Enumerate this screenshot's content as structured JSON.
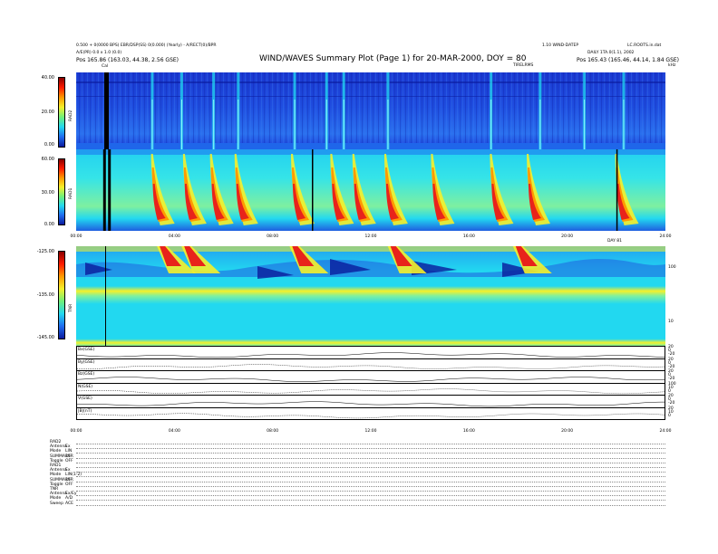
{
  "header": {
    "title": "WIND/WAVES Summary Plot (Page 1) for 20-MAR-2000, DOY = 80",
    "top_left_1": "0.500 + 0(0000 BPS) EBR/DSP(SS) 0(0.000) (Yearly) - A/RECT(0)/BPR",
    "top_left_2": "A/E(PR) 0.0 x 1.0 (0.0)",
    "top_left_3": "Pos    165.86 (163.03, 44.38, 2.56 GSE)",
    "top_right_1": "1.10 WIND-DATEP",
    "top_right_2": "LC.ROOTS.in.dat",
    "top_right_3": "DAILY 1TA.0(1.1), 2002",
    "top_right_4": "Pos    165.43 (165.46, 44.14, 1.84 GSE)",
    "top_center_small": "TIRELRMS",
    "right_corner": "kHz",
    "marker_label": "Cal"
  },
  "colors": {
    "bg_blue": "#1f3cd8",
    "dark_blue": "#0a1a9c",
    "cyan": "#22d8f0",
    "yellow": "#f5f02a",
    "red": "#e8231b",
    "black": "#000000"
  },
  "chart_data": [
    {
      "type": "heatmap",
      "name": "RAD2",
      "ylabel": "RAD2",
      "colorbar_ticks": [
        "40.00",
        "20.00",
        "0.00"
      ],
      "x_range_hours": [
        0,
        24
      ],
      "burst_hours": [
        3.1,
        4.3,
        5.6,
        6.6,
        8.9,
        10.2,
        10.9,
        12.7,
        16.9,
        18.9,
        20.7,
        22.3
      ]
    },
    {
      "type": "heatmap",
      "name": "RAD1",
      "ylabel": "RAD1",
      "colorbar_ticks": [
        "60.00",
        "30.00",
        "0.00"
      ],
      "x_range_hours": [
        0,
        24
      ],
      "xticks": [
        "00:00",
        "04:00",
        "08:00",
        "12:00",
        "16:00",
        "20:00",
        "24:00"
      ],
      "x_right_label": "DAY 81",
      "burst_hours": [
        3.2,
        4.5,
        5.6,
        6.6,
        8.9,
        10.5,
        11.4,
        12.7,
        14.6,
        17.0,
        18.5,
        22.1
      ],
      "gap_hours": [
        1.1,
        1.3,
        9.6,
        22.0
      ]
    },
    {
      "type": "heatmap",
      "name": "TNR",
      "ylabel": "TNR",
      "colorbar_ticks": [
        "-125.00",
        "-135.00",
        "-145.00"
      ],
      "x_range_hours": [
        0,
        24
      ],
      "right_ticks": [
        "100",
        "10"
      ],
      "burst_hours": [
        3.4,
        4.4,
        8.8,
        12.8,
        17.9
      ]
    },
    {
      "type": "line",
      "name": "Bx(GSE)",
      "ylabel": "Bx(GSE)",
      "right_ticks": [
        "20",
        "0",
        "-20"
      ]
    },
    {
      "type": "line",
      "name": "By(GSE)",
      "ylabel": "By(GSE)",
      "right_ticks": [
        "20",
        "0",
        "-20"
      ]
    },
    {
      "type": "line",
      "name": "Bz(GSE)",
      "ylabel": "Bz(GSE)",
      "right_ticks": [
        "20",
        "0",
        "-20"
      ]
    },
    {
      "type": "line",
      "name": "N(GSE)",
      "ylabel": "N(GSE)",
      "right_ticks": [
        "100",
        "10",
        "0"
      ]
    },
    {
      "type": "line",
      "name": "V(GSE)",
      "ylabel": "V(GSE)",
      "right_ticks": [
        "20",
        "0",
        "-20"
      ]
    },
    {
      "type": "line",
      "name": "|B|(nT)",
      "ylabel": "|B|(nT)",
      "right_ticks": [
        "20",
        "10",
        "0"
      ],
      "xticks": [
        "00:00",
        "04:00",
        "08:00",
        "12:00",
        "16:00",
        "20:00",
        "24:00"
      ]
    }
  ],
  "params": [
    [
      "RAD2",
      ""
    ],
    [
      "Antenna",
      "Ex"
    ],
    [
      "Mode",
      "LIN"
    ],
    [
      "SUMMARY",
      "16R"
    ],
    [
      "Toggle",
      "OFF"
    ],
    [
      "RAD1",
      ""
    ],
    [
      "Antenna",
      "Ex"
    ],
    [
      "Mode",
      "LIN(1-2)"
    ],
    [
      "SUMMARY",
      "16R"
    ],
    [
      "Toggle",
      "OFF"
    ],
    [
      "TNR",
      ""
    ],
    [
      "Antenna",
      "Ex/Ey"
    ],
    [
      "Mode",
      "A/D"
    ],
    [
      "Sweep",
      "ACE"
    ]
  ]
}
